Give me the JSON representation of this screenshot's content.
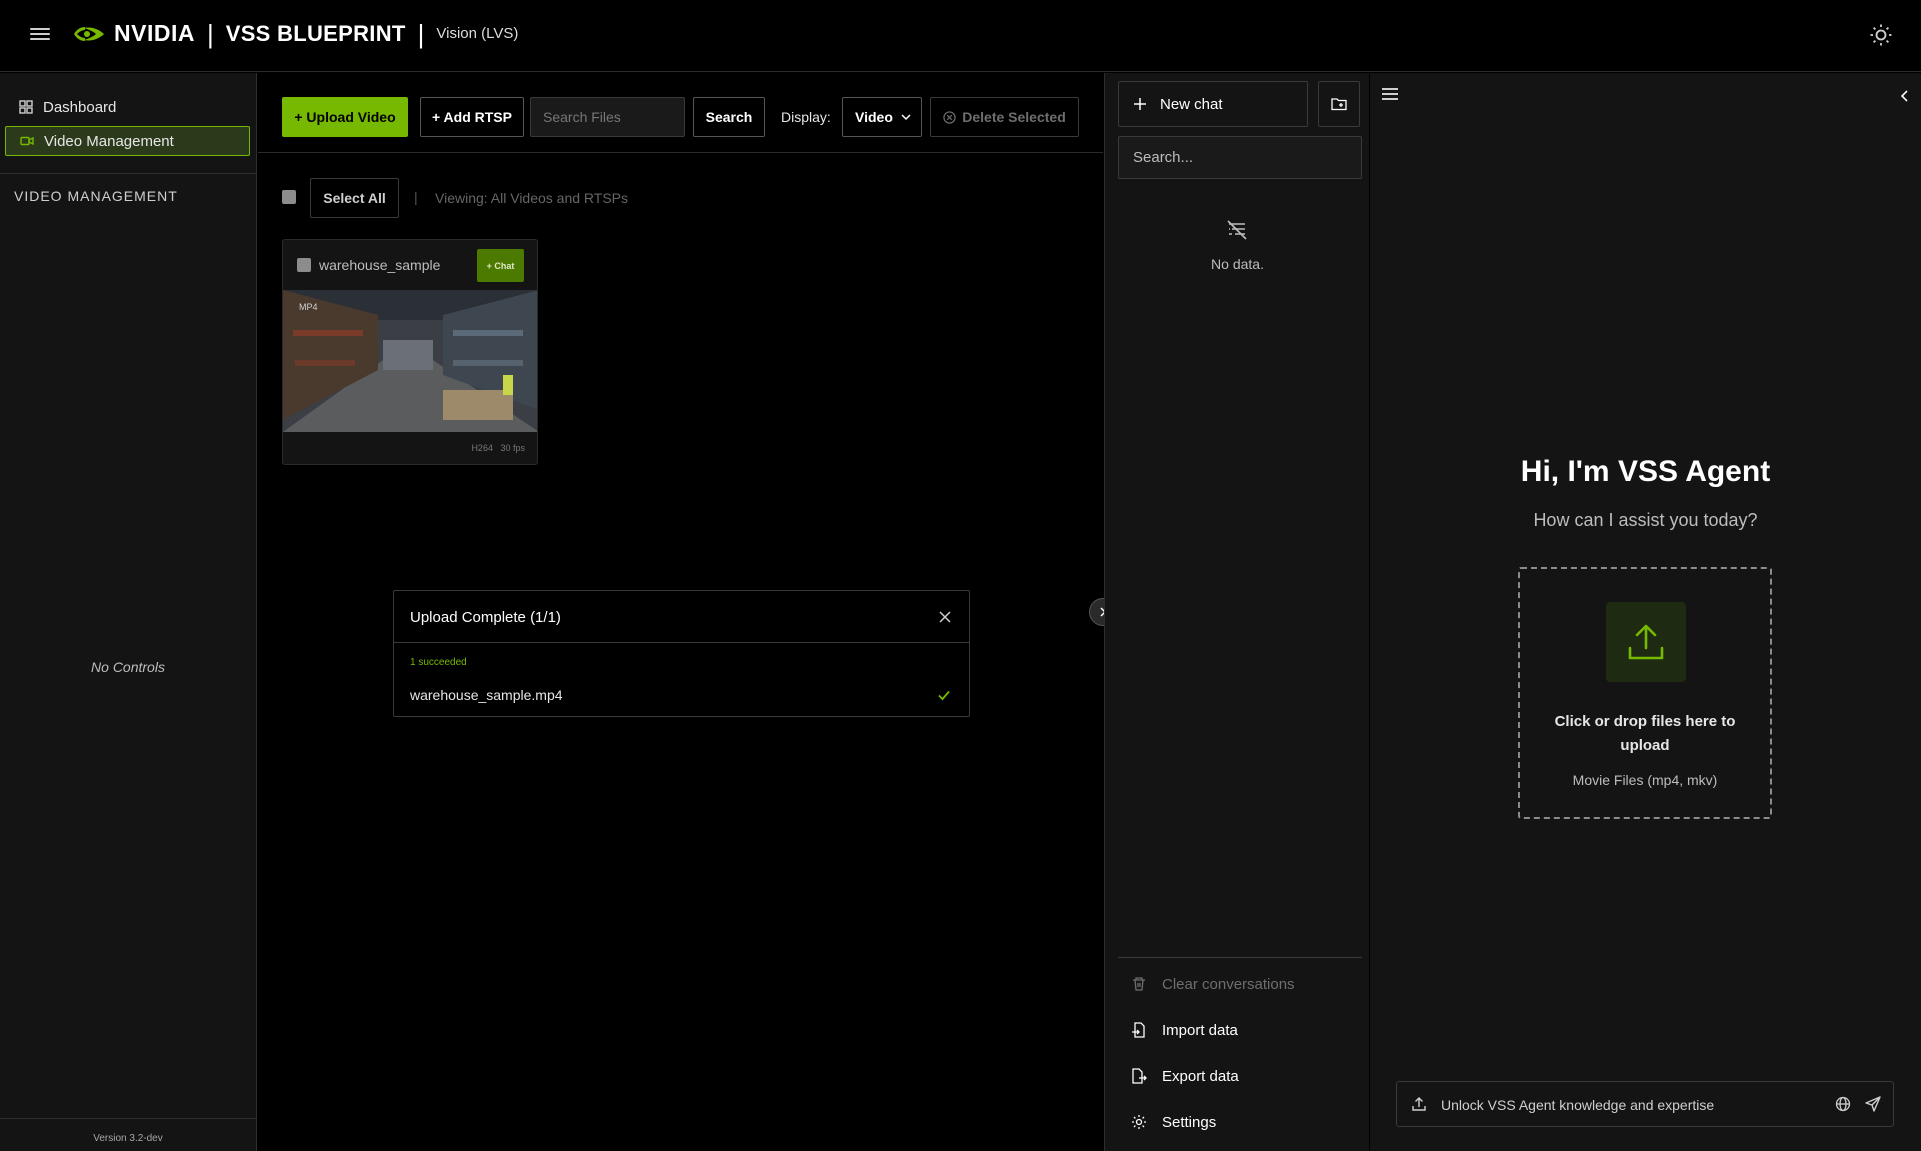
{
  "header": {
    "brand": "NVIDIA",
    "title": "VSS BLUEPRINT",
    "subtitle": "Vision (LVS)"
  },
  "sidebar": {
    "items": [
      {
        "label": "Dashboard",
        "icon": "dashboard-icon",
        "active": false
      },
      {
        "label": "Video Management",
        "icon": "video-icon",
        "active": true
      }
    ],
    "section_title": "VIDEO MANAGEMENT",
    "no_controls": "No Controls",
    "version": "Version 3.2-dev"
  },
  "toolbar": {
    "upload_label": "+ Upload Video",
    "rtsp_label": "+ Add RTSP",
    "search_placeholder": "Search Files",
    "search_label": "Search",
    "display_label": "Display:",
    "display_value": "Video",
    "delete_label": "Delete Selected"
  },
  "selection": {
    "select_all_label": "Select All",
    "separator": "|",
    "viewing_text": "Viewing: All Videos and RTSPs"
  },
  "video_card": {
    "title": "warehouse_sample",
    "chat_label": "+ Chat",
    "format_badge": "MP4",
    "codec": "H264",
    "fps": "30 fps"
  },
  "upload_toast": {
    "title": "Upload Complete (1/1)",
    "status": "1 succeeded",
    "file": "warehouse_sample.mp4"
  },
  "history": {
    "new_chat_label": "New chat",
    "search_placeholder": "Search...",
    "empty_text": "No data.",
    "actions": [
      {
        "label": "Clear conversations",
        "icon": "trash-icon",
        "enabled": false
      },
      {
        "label": "Import data",
        "icon": "import-icon",
        "enabled": true
      },
      {
        "label": "Export data",
        "icon": "export-icon",
        "enabled": true
      },
      {
        "label": "Settings",
        "icon": "gear-icon",
        "enabled": true
      }
    ]
  },
  "agent": {
    "title": "Hi, I'm VSS Agent",
    "subtitle": "How can I assist you today?",
    "dropzone_text": "Click or drop files here to upload",
    "dropzone_types": "Movie Files (mp4, mkv)",
    "composer_placeholder": "Unlock VSS Agent knowledge and expertise"
  },
  "colors": {
    "accent": "#76b900",
    "background": "#000000",
    "panel": "#141414"
  }
}
